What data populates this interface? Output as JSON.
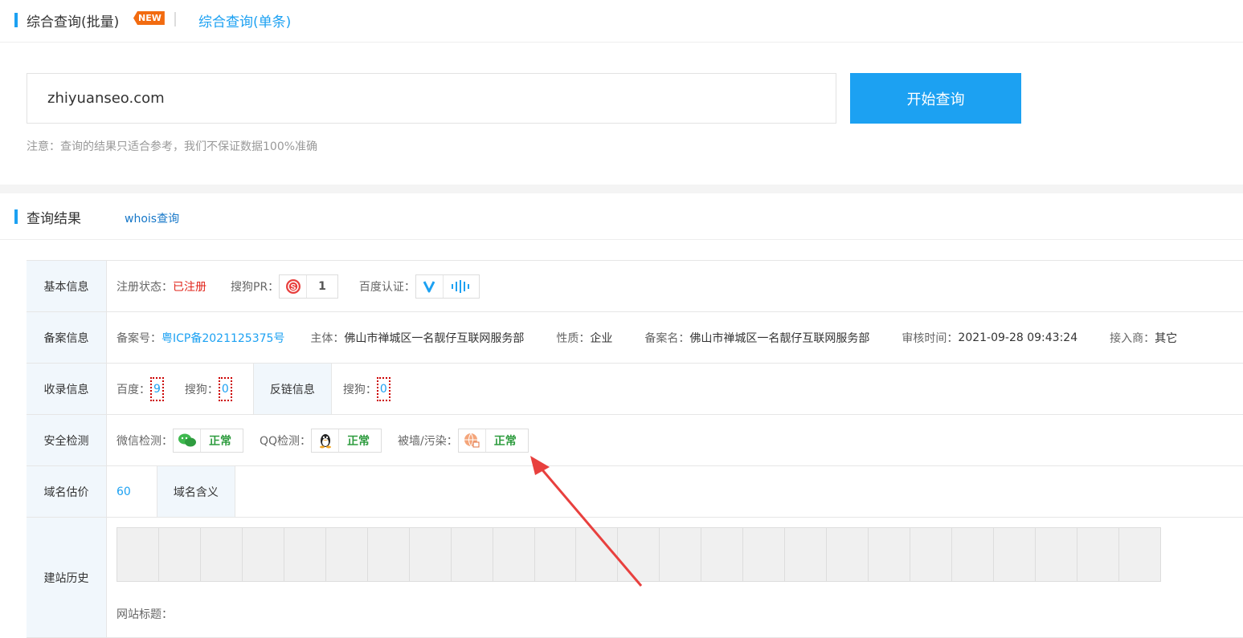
{
  "tabs": {
    "batch": "综合查询(批量)",
    "new_badge": "NEW",
    "single": "综合查询(单条)"
  },
  "search": {
    "value": "zhiyuanseo.com",
    "button": "开始查询",
    "notice": "注意：查询的结果只适合参考，我们不保证数据100%准确"
  },
  "result": {
    "title": "查询结果",
    "whois": "whois查询"
  },
  "basic": {
    "label": "基本信息",
    "reg_key": "注册状态：",
    "reg_val": "已注册",
    "pr_key": "搜狗PR：",
    "pr_val": "1",
    "baidu_key": "百度认证："
  },
  "icp": {
    "label": "备案信息",
    "no_key": "备案号：",
    "no_val": "粤ICP备2021125375号",
    "owner_key": "主体：",
    "owner_val": "佛山市禅城区一名靓仔互联网服务部",
    "type_key": "性质：",
    "type_val": "企业",
    "name_key": "备案名：",
    "name_val": "佛山市禅城区一名靓仔互联网服务部",
    "time_key": "审核时间：",
    "time_val": "2021-09-28 09:43:24",
    "isp_key": "接入商：",
    "isp_val": "其它"
  },
  "index": {
    "label": "收录信息",
    "baidu_key": "百度：",
    "baidu_val": "9",
    "sogou_key": "搜狗：",
    "sogou_val": "0",
    "backlink_label": "反链信息",
    "bl_sogou_key": "搜狗：",
    "bl_sogou_val": "0"
  },
  "security": {
    "label": "安全检测",
    "wechat_key": "微信检测：",
    "wechat_val": "正常",
    "qq_key": "QQ检测：",
    "qq_val": "正常",
    "wall_key": "被墙/污染：",
    "wall_val": "正常"
  },
  "valuation": {
    "label": "域名估价",
    "value": "60",
    "meaning_label": "域名含义"
  },
  "history": {
    "label": "建站历史",
    "site_title_key": "网站标题："
  },
  "colors": {
    "accent": "#1ca1f2",
    "ok": "#2e9c3f",
    "danger": "#e1251b",
    "arrow": "#e8403e"
  }
}
